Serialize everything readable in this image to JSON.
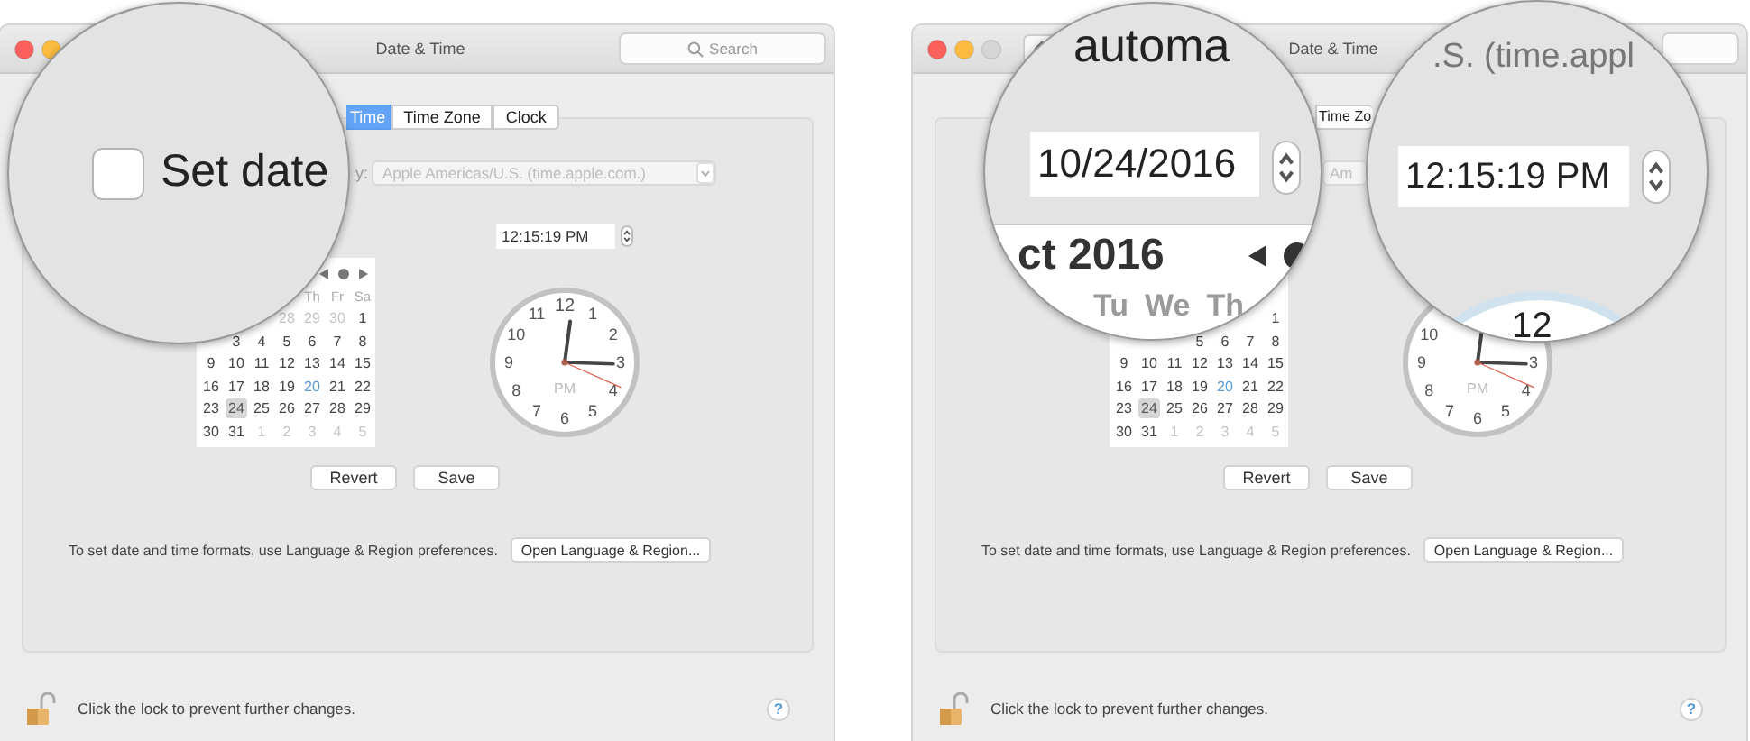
{
  "windows": [
    {
      "title": "Date & Time",
      "search": {
        "placeholder": "Search"
      },
      "tabs": [
        {
          "label": "Time",
          "selected": true
        },
        {
          "label": "Time Zone",
          "selected": false
        },
        {
          "label": "Clock",
          "selected": false
        }
      ],
      "server": {
        "label": "y:",
        "value": "Apple Americas/U.S. (time.apple.com.)",
        "disabled": true
      },
      "time_field": {
        "value": "12:15:19 PM"
      },
      "calendar": {
        "nav": true,
        "weekdays": [
          "Th",
          "Fr",
          "Sa"
        ],
        "weeks": [
          [
            {
              "d": "28",
              "kind": "other",
              "selected": false
            },
            {
              "d": "29",
              "kind": "other",
              "selected": false
            },
            {
              "d": "30",
              "kind": "other",
              "selected": false
            },
            {
              "d": "1",
              "kind": "day",
              "selected": false
            }
          ],
          [
            {
              "d": "3",
              "kind": "day",
              "selected": false
            },
            {
              "d": "4",
              "kind": "day",
              "selected": false
            },
            {
              "d": "5",
              "kind": "day",
              "selected": false
            },
            {
              "d": "6",
              "kind": "day",
              "selected": false
            },
            {
              "d": "7",
              "kind": "day",
              "selected": false
            },
            {
              "d": "8",
              "kind": "day",
              "selected": false
            }
          ],
          [
            {
              "d": "9",
              "kind": "day",
              "selected": false
            },
            {
              "d": "10",
              "kind": "day",
              "selected": false
            },
            {
              "d": "11",
              "kind": "day",
              "selected": false
            },
            {
              "d": "12",
              "kind": "day",
              "selected": false
            },
            {
              "d": "13",
              "kind": "day",
              "selected": false
            },
            {
              "d": "14",
              "kind": "day",
              "selected": false
            },
            {
              "d": "15",
              "kind": "day",
              "selected": false
            }
          ],
          [
            {
              "d": "16",
              "kind": "day",
              "selected": false
            },
            {
              "d": "17",
              "kind": "day",
              "selected": false
            },
            {
              "d": "18",
              "kind": "day",
              "selected": false
            },
            {
              "d": "19",
              "kind": "day",
              "selected": false
            },
            {
              "d": "20",
              "kind": "today",
              "selected": false
            },
            {
              "d": "21",
              "kind": "day",
              "selected": false
            },
            {
              "d": "22",
              "kind": "day",
              "selected": false
            }
          ],
          [
            {
              "d": "23",
              "kind": "day",
              "selected": false
            },
            {
              "d": "24",
              "kind": "day",
              "selected": true
            },
            {
              "d": "25",
              "kind": "day",
              "selected": false
            },
            {
              "d": "26",
              "kind": "day",
              "selected": false
            },
            {
              "d": "27",
              "kind": "day",
              "selected": false
            },
            {
              "d": "28",
              "kind": "day",
              "selected": false
            },
            {
              "d": "29",
              "kind": "day",
              "selected": false
            }
          ],
          [
            {
              "d": "30",
              "kind": "day",
              "selected": false
            },
            {
              "d": "31",
              "kind": "day",
              "selected": false
            },
            {
              "d": "1",
              "kind": "other",
              "selected": false
            },
            {
              "d": "2",
              "kind": "other",
              "selected": false
            },
            {
              "d": "3",
              "kind": "other",
              "selected": false
            },
            {
              "d": "4",
              "kind": "other",
              "selected": false
            },
            {
              "d": "5",
              "kind": "other",
              "selected": false
            }
          ]
        ]
      },
      "clock": {
        "numerals": [
          "12",
          "11",
          "1",
          "10",
          "2",
          "9",
          "3",
          "8",
          "4",
          "7",
          "5",
          "6"
        ],
        "meridiem": "PM"
      },
      "buttons": [
        "Revert",
        "Save"
      ],
      "formats": {
        "text": "To set date and time formats, use Language & Region preferences.",
        "button": "Open Language & Region..."
      },
      "lock": {
        "text": "Click the lock to prevent further changes.",
        "locked": false
      },
      "help": "?",
      "lenses": [
        {
          "kind": "checkbox",
          "checked": false,
          "label": "Set date"
        }
      ]
    },
    {
      "title": "Date & Time",
      "tabs": [
        {
          "label": "Time Zo",
          "selected": false
        }
      ],
      "server": {
        "value": "Am",
        "disabled": true
      },
      "calendar": {
        "weeks": [
          [
            {
              "d": "1",
              "kind": "day",
              "selected": false
            }
          ],
          [
            {
              "d": "5",
              "kind": "day",
              "selected": false
            },
            {
              "d": "6",
              "kind": "day",
              "selected": false
            },
            {
              "d": "7",
              "kind": "day",
              "selected": false
            },
            {
              "d": "8",
              "kind": "day",
              "selected": false
            }
          ],
          [
            {
              "d": "9",
              "kind": "day",
              "selected": false
            },
            {
              "d": "10",
              "kind": "day",
              "selected": false
            },
            {
              "d": "11",
              "kind": "day",
              "selected": false
            },
            {
              "d": "12",
              "kind": "day",
              "selected": false
            },
            {
              "d": "13",
              "kind": "day",
              "selected": false
            },
            {
              "d": "14",
              "kind": "day",
              "selected": false
            },
            {
              "d": "15",
              "kind": "day",
              "selected": false
            }
          ],
          [
            {
              "d": "16",
              "kind": "day",
              "selected": false
            },
            {
              "d": "17",
              "kind": "day",
              "selected": false
            },
            {
              "d": "18",
              "kind": "day",
              "selected": false
            },
            {
              "d": "19",
              "kind": "day",
              "selected": false
            },
            {
              "d": "20",
              "kind": "today",
              "selected": false
            },
            {
              "d": "21",
              "kind": "day",
              "selected": false
            },
            {
              "d": "22",
              "kind": "day",
              "selected": false
            }
          ],
          [
            {
              "d": "23",
              "kind": "day",
              "selected": false
            },
            {
              "d": "24",
              "kind": "day",
              "selected": true
            },
            {
              "d": "25",
              "kind": "day",
              "selected": false
            },
            {
              "d": "26",
              "kind": "day",
              "selected": false
            },
            {
              "d": "27",
              "kind": "day",
              "selected": false
            },
            {
              "d": "28",
              "kind": "day",
              "selected": false
            },
            {
              "d": "29",
              "kind": "day",
              "selected": false
            }
          ],
          [
            {
              "d": "30",
              "kind": "day",
              "selected": false
            },
            {
              "d": "31",
              "kind": "day",
              "selected": false
            },
            {
              "d": "1",
              "kind": "other",
              "selected": false
            },
            {
              "d": "2",
              "kind": "other",
              "selected": false
            },
            {
              "d": "3",
              "kind": "other",
              "selected": false
            },
            {
              "d": "4",
              "kind": "other",
              "selected": false
            },
            {
              "d": "5",
              "kind": "other",
              "selected": false
            }
          ]
        ]
      },
      "clock": {
        "numerals": [
          "10",
          "9",
          "3",
          "8",
          "4",
          "7",
          "5",
          "6"
        ],
        "meridiem": "PM"
      },
      "buttons": [
        "Revert",
        "Save"
      ],
      "formats": {
        "text": "To set date and time formats, use Language & Region preferences.",
        "button": "Open Language & Region..."
      },
      "lock": {
        "text": "Click the lock to prevent further changes.",
        "locked": false
      },
      "help": "?",
      "lenses": [
        {
          "kind": "date",
          "caption": "automa",
          "value": "10/24/2016",
          "month": "ct 2016",
          "weekdays": [
            "Tu",
            "We",
            "Th"
          ]
        },
        {
          "kind": "time",
          "caption": ".S. (time.appl",
          "value": "12:15:19 PM",
          "numeral": "12"
        }
      ]
    }
  ]
}
